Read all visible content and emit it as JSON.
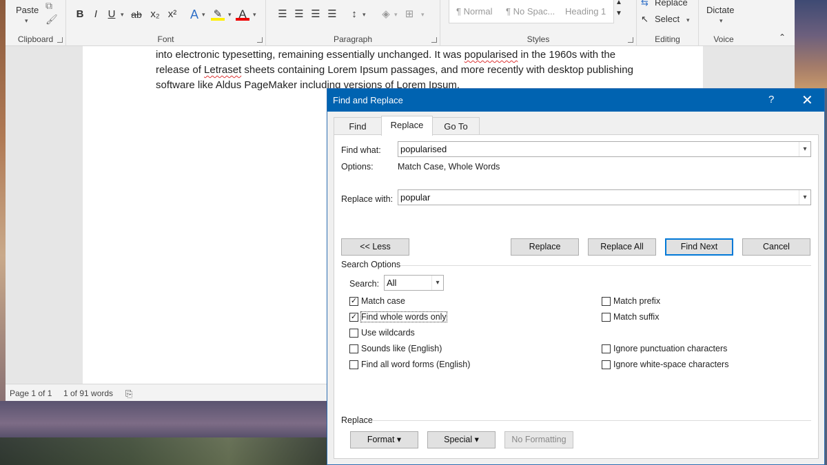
{
  "ribbon": {
    "clipboard": {
      "paste_label": "Paste",
      "group_label": "Clipboard"
    },
    "font": {
      "group_label": "Font",
      "bold": "B",
      "italic": "I",
      "underline": "U",
      "strike": "ab",
      "subscript": "x₂",
      "superscript": "x²",
      "text_effects": "A",
      "highlight": "✎",
      "font_color": "A"
    },
    "paragraph": {
      "group_label": "Paragraph"
    },
    "styles": {
      "group_label": "Styles",
      "items": [
        "¶ Normal",
        "¶ No Spac...",
        "Heading 1"
      ]
    },
    "editing": {
      "group_label": "Editing",
      "replace_label": "Replace",
      "select_label": "Select"
    },
    "voice": {
      "group_label": "Voice",
      "dictate_label": "Dictate"
    }
  },
  "document": {
    "line1": "into electronic typesetting, remaining essentially unchanged. It was",
    "line1_word": "popularised",
    "line1_tail": "in the 1960s with the",
    "line2_head": "release of",
    "line2_word": "Letraset",
    "line2_tail": "sheets containing Lorem Ipsum passages, and more recently with desktop publishing",
    "line3": "software like Aldus PageMaker including versions of Lorem Ipsum."
  },
  "status": {
    "page": "Page 1 of 1",
    "words": "1 of 91 words"
  },
  "dialog": {
    "title": "Find and Replace",
    "help": "?",
    "close": "✕",
    "tabs": [
      "Find",
      "Replace",
      "Go To"
    ],
    "find_what_label": "Find what:",
    "find_what_value": "popularised",
    "options_label": "Options:",
    "options_value": "Match Case, Whole Words",
    "replace_with_label": "Replace with:",
    "replace_with_value": "popular",
    "buttons": {
      "less": "<< Less",
      "replace": "Replace",
      "replace_all": "Replace All",
      "find_next": "Find Next",
      "cancel": "Cancel"
    },
    "search_options_label": "Search Options",
    "search_label": "Search:",
    "search_value": "All",
    "checkboxes_left": [
      {
        "label": "Match case",
        "checked": true
      },
      {
        "label": "Find whole words only",
        "checked": true
      },
      {
        "label": "Use wildcards",
        "checked": false
      },
      {
        "label": "Sounds like (English)",
        "checked": false
      },
      {
        "label": "Find all word forms (English)",
        "checked": false
      }
    ],
    "checkboxes_right": [
      {
        "label": "Match prefix",
        "checked": false
      },
      {
        "label": "Match suffix",
        "checked": false
      },
      {
        "label": "Ignore punctuation characters",
        "checked": false
      },
      {
        "label": "Ignore white-space characters",
        "checked": false
      }
    ],
    "replace_section_label": "Replace",
    "format_button": "Format ▾",
    "special_button": "Special ▾",
    "no_formatting_button": "No Formatting"
  }
}
